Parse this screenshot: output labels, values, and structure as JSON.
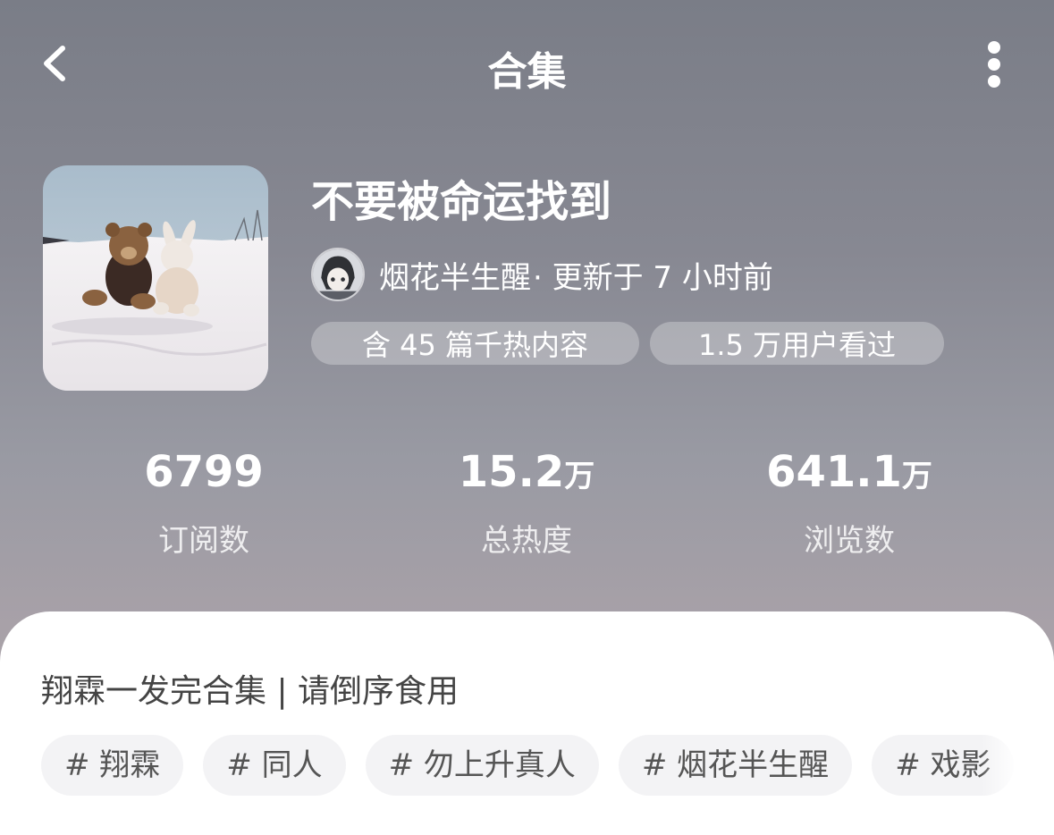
{
  "header": {
    "title": "合集",
    "back_icon": "chevron-left-icon",
    "more_icon": "more-vertical-icon"
  },
  "collection": {
    "title": "不要被命运找到",
    "author": "烟花半生醒",
    "update_text": "· 更新于 7 小时前",
    "pill_posts": "含 45 篇千热内容",
    "pill_viewers": "1.5 万用户看过"
  },
  "stats": {
    "subscribers": {
      "value": "6799",
      "unit": "",
      "label": "订阅数"
    },
    "heat": {
      "value": "15.2",
      "unit": "万",
      "label": "总热度"
    },
    "views": {
      "value": "641.1",
      "unit": "万",
      "label": "浏览数"
    }
  },
  "description": "翔霖一发完合集 | 请倒序食用",
  "tags": [
    "# 翔霖",
    "# 同人",
    "# 勿上升真人",
    "# 烟花半生醒",
    "# 戏影"
  ]
}
